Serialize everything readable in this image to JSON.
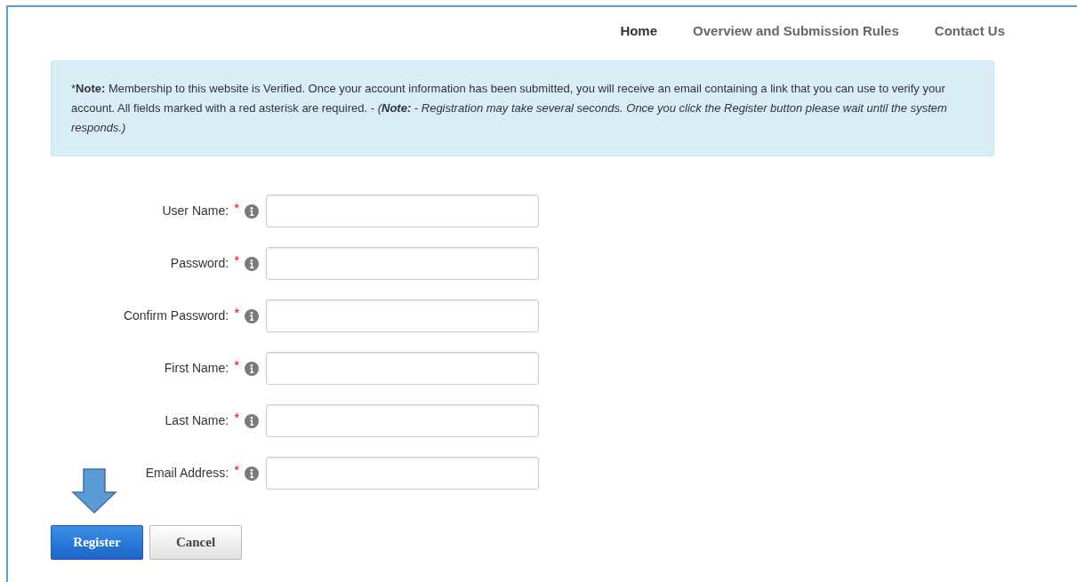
{
  "nav": [
    {
      "label": "Home",
      "selected": true
    },
    {
      "label": "Overview and Submission Rules",
      "selected": false
    },
    {
      "label": "Contact Us",
      "selected": false
    }
  ],
  "note": [
    {
      "text": "*",
      "bold": false,
      "italic": false
    },
    {
      "text": "Note:",
      "bold": true,
      "italic": false
    },
    {
      "text": " Membership to this website is Verified. Once your account information has been submitted, you will receive an email containing a link that you can use to verify your account. All fields marked with a red asterisk are required. - ",
      "bold": false,
      "italic": false
    },
    {
      "text": "(",
      "bold": false,
      "italic": true
    },
    {
      "text": "Note:",
      "bold": true,
      "italic": true
    },
    {
      "text": " - Registration may take several seconds. Once you click the Register button please wait until the system responds.)",
      "bold": false,
      "italic": true
    }
  ],
  "fields": [
    {
      "label": "User Name:",
      "required": true
    },
    {
      "label": "Password:",
      "required": true
    },
    {
      "label": "Confirm Password:",
      "required": true
    },
    {
      "label": "First Name:",
      "required": true
    },
    {
      "label": "Last Name:",
      "required": true
    },
    {
      "label": "Email Address:",
      "required": true
    }
  ],
  "buttons": [
    {
      "label": "Register",
      "kind": "primary"
    },
    {
      "label": "Cancel",
      "kind": "secondary"
    }
  ]
}
